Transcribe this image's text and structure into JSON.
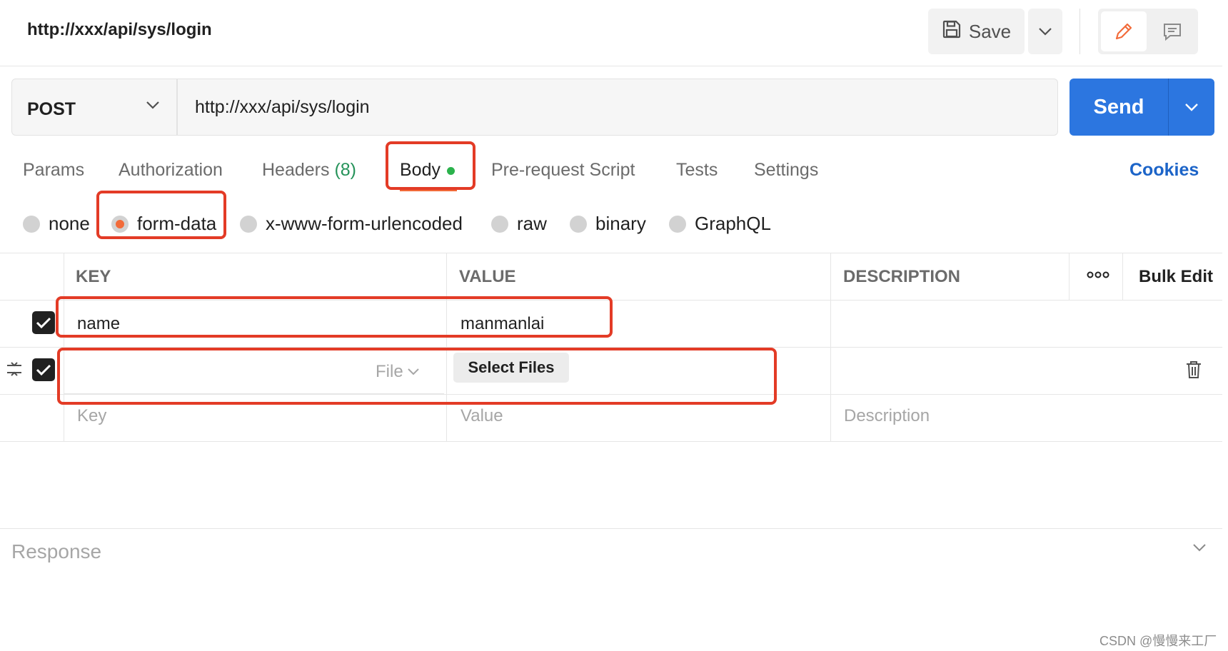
{
  "header": {
    "request_title": "http://xxx/api/sys/login",
    "save_label": "Save"
  },
  "request": {
    "method": "POST",
    "url": "http://xxx/api/sys/login",
    "send_label": "Send"
  },
  "tabs": {
    "params": "Params",
    "authorization": "Authorization",
    "headers": "Headers",
    "headers_count": "(8)",
    "body": "Body",
    "prerequest": "Pre-request Script",
    "tests": "Tests",
    "settings": "Settings",
    "active": "Body"
  },
  "cookies_label": "Cookies",
  "body_types": {
    "none": "none",
    "form_data": "form-data",
    "urlencoded": "x-www-form-urlencoded",
    "raw": "raw",
    "binary": "binary",
    "graphql": "GraphQL",
    "selected": "form-data"
  },
  "table": {
    "columns": {
      "key": "KEY",
      "value": "VALUE",
      "description": "DESCRIPTION"
    },
    "more_label": "ooo",
    "bulk_edit": "Bulk Edit",
    "rows": [
      {
        "checked": true,
        "key": "name",
        "value": "manmanlai",
        "description": ""
      },
      {
        "checked": true,
        "key": "",
        "type": "File",
        "select_files": "Select Files",
        "description": ""
      }
    ],
    "new_row": {
      "key_placeholder": "Key",
      "value_placeholder": "Value",
      "description_placeholder": "Description"
    }
  },
  "response_label": "Response",
  "watermark": "CSDN @慢慢来工厂",
  "colors": {
    "send_blue": "#2c76e0",
    "active_orange": "#f26b3a",
    "annotation_red": "#e33b26",
    "status_green": "#2bb24c"
  },
  "icons": {
    "save": "save-icon",
    "edit": "pencil-icon",
    "comment": "comment-icon",
    "drag": "drag-handle-icon",
    "delete": "trash-icon",
    "chevron": "chevron-down-icon"
  }
}
